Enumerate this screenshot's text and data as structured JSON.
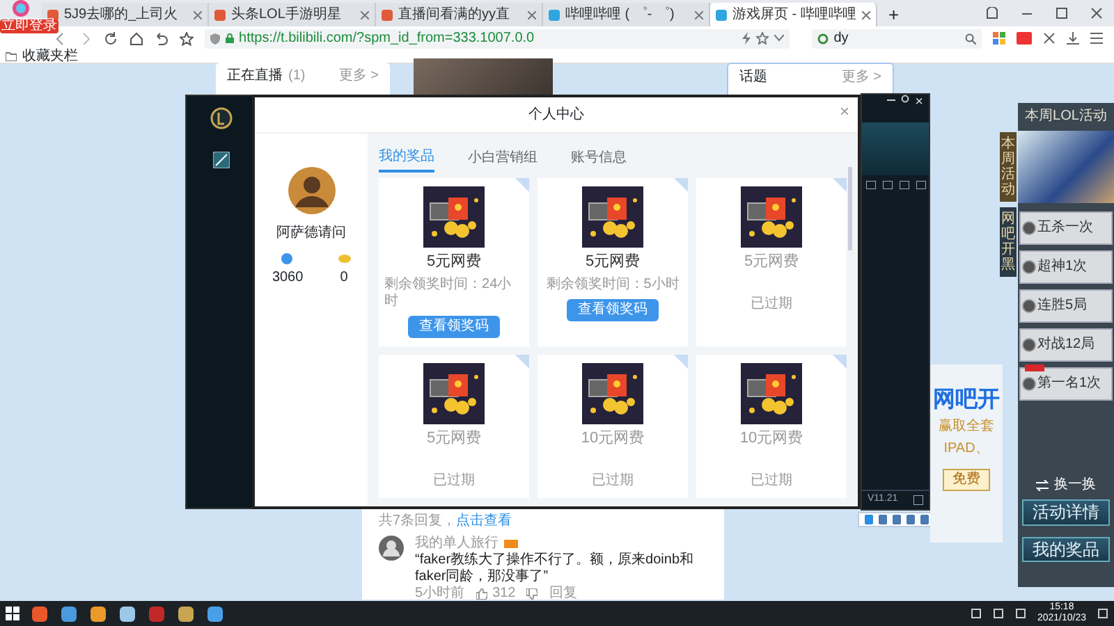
{
  "browser": {
    "logo_badge": "立即登录",
    "tabs": [
      {
        "label": "5J9去哪的_上司火",
        "selected": false
      },
      {
        "label": "头条LOL手游明星",
        "selected": false
      },
      {
        "label": "直播间看满的yy直",
        "selected": false
      },
      {
        "label": "哔哩哔哩 ( ゜- ゜)",
        "selected": false
      },
      {
        "label": "游戏屏页 - 哔哩哔哩",
        "selected": true
      }
    ],
    "new_tab": "+",
    "url": "https://t.bilibili.com/?spm_id_from=333.1007.0.0",
    "search": "dy",
    "bookmarks": "收藏夹栏"
  },
  "page": {
    "live_card": {
      "title": "正在直播",
      "count": "(1)",
      "more": "更多 >"
    },
    "topic_card": {
      "title": "话题",
      "more": "更多 >"
    },
    "replies": {
      "text": "共7条回复，",
      "link": "点击查看"
    },
    "comment": {
      "user": "我的单人旅行",
      "text": "“faker教练大了操作不行了。额，原来doinb和faker同龄，那没事了”",
      "time": "5小时前",
      "likes": "312",
      "reply": "回复"
    }
  },
  "modal": {
    "title": "个人中心",
    "close": "×",
    "user": "阿萨德请问",
    "stats": [
      "3060",
      "0"
    ],
    "tabs": [
      {
        "label": "我的奖品",
        "selected": true
      },
      {
        "label": "小白营销组",
        "selected": false
      },
      {
        "label": "账号信息",
        "selected": false
      }
    ],
    "prizes": [
      {
        "kind": "active",
        "name": "5元网费",
        "remaining": "剩余领奖时间：24小时",
        "button": "查看领奖码"
      },
      {
        "kind": "active",
        "name": "5元网费",
        "remaining": "剩余领奖时间：5小时",
        "button": "查看领奖码"
      },
      {
        "kind": "expired",
        "name": "5元网费",
        "status": "已过期"
      },
      {
        "kind": "expired",
        "name": "5元网费",
        "status": "已过期"
      },
      {
        "kind": "expired",
        "name": "10元网费",
        "status": "已过期"
      },
      {
        "kind": "expired",
        "name": "10元网费",
        "status": "已过期"
      }
    ]
  },
  "chat": {
    "close": "×",
    "version": "V11.21"
  },
  "ad": {
    "headline": "网吧开",
    "line1": "赢取全套",
    "line2": "IPAD、",
    "button": "免费"
  },
  "lol_panel": {
    "title": "本周LOL活动",
    "side_tabs": [
      {
        "label": "本周活动",
        "selected": true
      },
      {
        "label": "网吧开黑",
        "selected": false
      }
    ],
    "tasks": [
      {
        "label": "五杀一次",
        "tagged": false
      },
      {
        "label": "超神1次",
        "tagged": false
      },
      {
        "label": "连胜5局",
        "tagged": false
      },
      {
        "label": "对战12局",
        "tagged": false
      },
      {
        "label": "第一名1次",
        "tagged": true
      }
    ],
    "shuffle": "换一换",
    "buttons": [
      "活动详情",
      "我的奖品"
    ]
  },
  "taskbar": {
    "time": "15:18",
    "date": "2021/10/23"
  }
}
